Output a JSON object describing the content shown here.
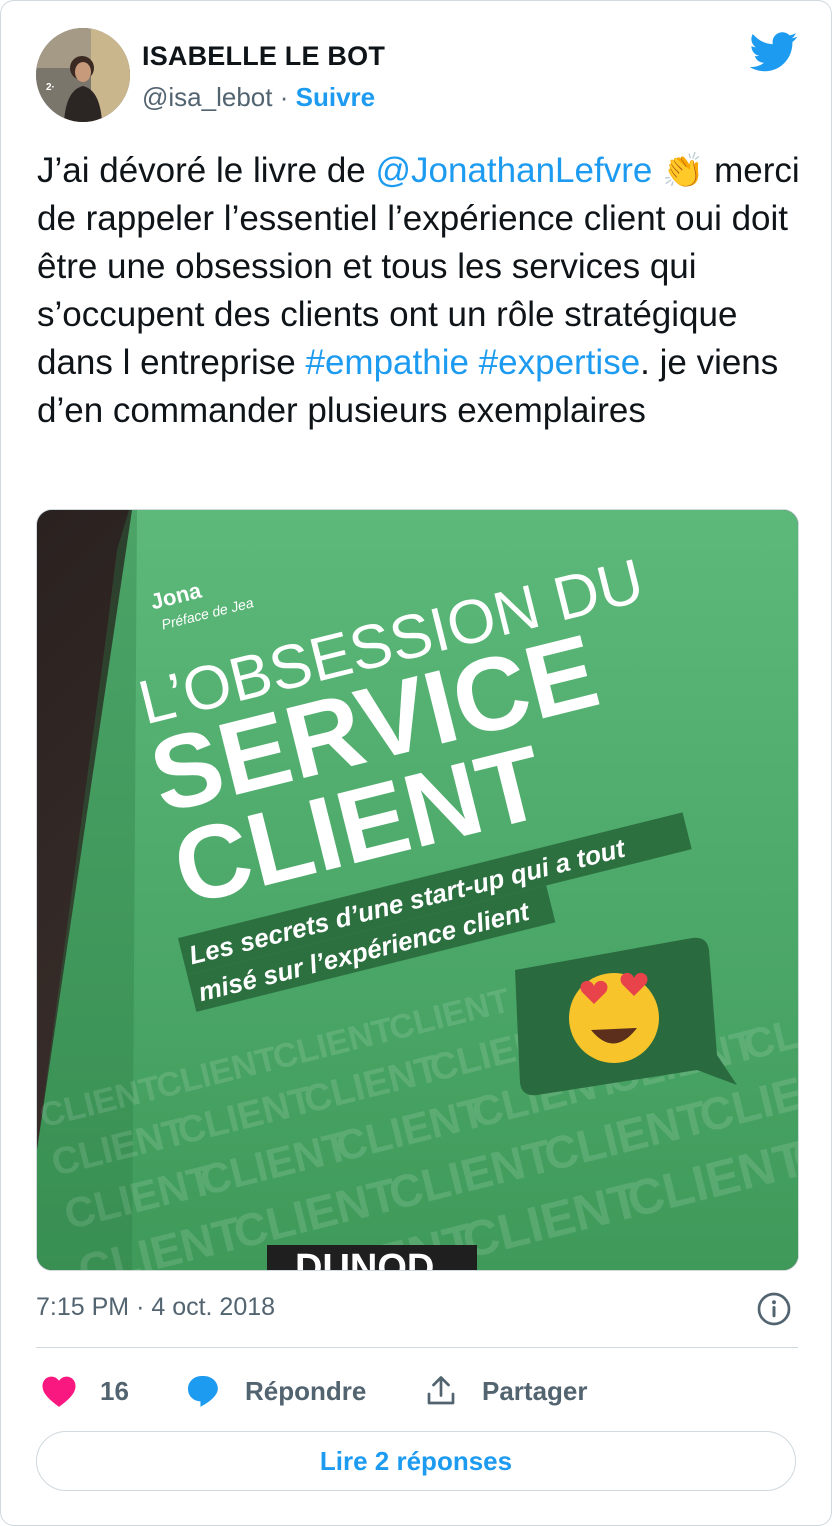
{
  "author": {
    "name": "ISABELLE LE BOT",
    "handle": "@isa_lebot",
    "separator": "·",
    "follow_label": "Suivre"
  },
  "tweet": {
    "text_parts": {
      "p1": "J’ai dévoré le livre de ",
      "mention": "@JonathanLefvre",
      "p2": " merci de rappeler l’essentiel l’expérience client oui doit être une obsession et tous les services qui s’occupent des clients ont un rôle stratégique dans l entreprise ",
      "hashtag1": "#empathie",
      "space": " ",
      "hashtag2": "#expertise",
      "p3": ". je viens d’en commander plusieurs exemplaires"
    },
    "emoji": "👏"
  },
  "media": {
    "book_author_partial": "Jona",
    "preface_partial": "Préface de Jea",
    "title_line1": "L’OBSESSION DU",
    "title_line2": "SERVICE",
    "title_line3": "CLIENT",
    "subtitle_line1": "Les secrets d’une start-up qui a tout",
    "subtitle_line2": "misé sur l’expérience client",
    "pattern_word": "CLIENT",
    "publisher": "DUNOD"
  },
  "meta": {
    "time": "7:15 PM",
    "separator": "·",
    "date": "4 oct. 2018"
  },
  "actions": {
    "likes_count": "16",
    "reply_label": "Répondre",
    "share_label": "Partager"
  },
  "read_replies_label": "Lire 2 réponses",
  "colors": {
    "accent": "#1d9bf0",
    "like": "#f91880",
    "text": "#0f1419",
    "muted": "#536471",
    "border": "#cfd9de",
    "book_green": "#4fae6a"
  },
  "icons": [
    "twitter-bird-icon",
    "info-icon",
    "heart-icon",
    "reply-bubble-icon",
    "share-icon",
    "clap-emoji-icon"
  ]
}
